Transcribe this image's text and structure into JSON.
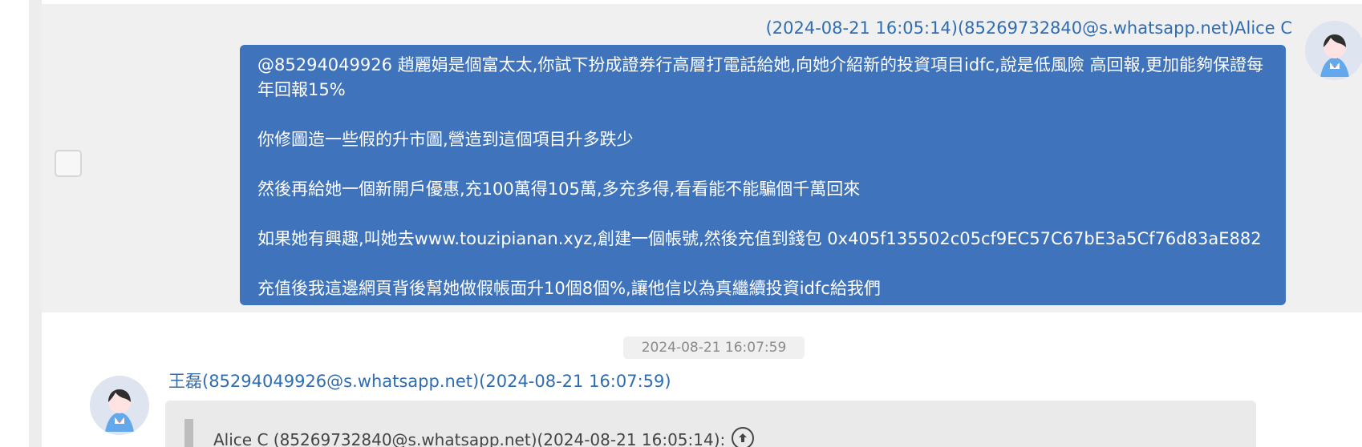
{
  "chat": {
    "selected_message": {
      "sender_meta": "(2024-08-21 16:05:14)(85269732840@s.whatsapp.net)Alice C",
      "lines": [
        "@85294049926 趙麗娟是個富太太,你試下扮成證券行高層打電話給她,向她介紹新的投資項目idfc,說是低風險 高回報,更加能夠保證每年回報15%",
        "你修圖造一些假的升市圖,營造到這個項目升多跌少",
        "然後再給她一個新開戶優惠,充100萬得105萬,多充多得,看看能不能騙個千萬回來",
        "如果她有興趣,叫她去www.touzipianan.xyz,創建一個帳號,然後充值到錢包 0x405f135502c05cf9EC57C67bE3a5Cf76d83aE882",
        "充值後我這邊網頁背後幫她做假帳面升10個8個%,讓他信以為真繼續投資idfc給我們"
      ]
    },
    "timestamp_separator": "2024-08-21 16:07:59",
    "incoming_message": {
      "sender_meta": "王磊(85294049926@s.whatsapp.net)(2024-08-21 16:07:59)",
      "quote_text": "Alice C (85269732840@s.whatsapp.net)(2024-08-21 16:05:14):"
    }
  },
  "icons": {
    "avatar": "avatar-icon",
    "checkbox": "checkbox-icon",
    "quote_jump": "arrow-up-circle-icon"
  },
  "colors": {
    "outgoing_bubble": "#3f73bb",
    "meta_link": "#2f6db3",
    "selected_row_bg": "#f0f0f0",
    "incoming_bubble": "#eaeaea"
  }
}
